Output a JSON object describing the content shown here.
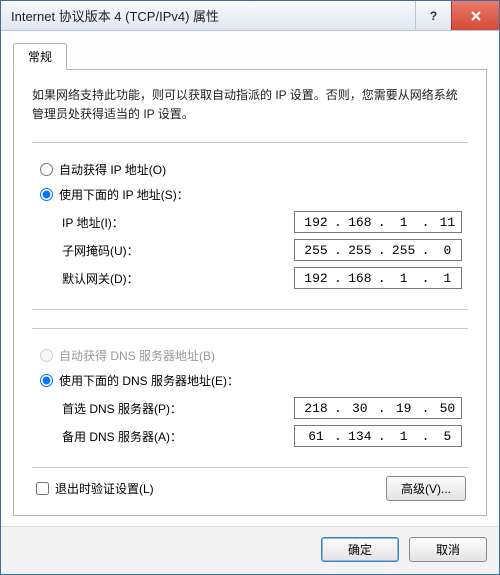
{
  "window": {
    "title": "Internet 协议版本 4 (TCP/IPv4) 属性"
  },
  "tab": {
    "general": "常规"
  },
  "intro": "如果网络支持此功能，则可以获取自动指派的 IP 设置。否则，您需要从网络系统管理员处获得适当的 IP 设置。",
  "ip": {
    "auto_label": "自动获得 IP 地址(O)",
    "manual_label": "使用下面的 IP 地址(S)：",
    "ip_label": "IP 地址(I)：",
    "mask_label": "子网掩码(U)：",
    "gateway_label": "默认网关(D)：",
    "ip_value": [
      "192",
      "168",
      "1",
      "11"
    ],
    "mask_value": [
      "255",
      "255",
      "255",
      "0"
    ],
    "gateway_value": [
      "192",
      "168",
      "1",
      "1"
    ]
  },
  "dns": {
    "auto_label": "自动获得 DNS 服务器地址(B)",
    "manual_label": "使用下面的 DNS 服务器地址(E)：",
    "preferred_label": "首选 DNS 服务器(P)：",
    "alternate_label": "备用 DNS 服务器(A)：",
    "preferred_value": [
      "218",
      "30",
      "19",
      "50"
    ],
    "alternate_value": [
      "61",
      "134",
      "1",
      "5"
    ]
  },
  "validate_label": "退出时验证设置(L)",
  "buttons": {
    "advanced": "高级(V)...",
    "ok": "确定",
    "cancel": "取消"
  }
}
